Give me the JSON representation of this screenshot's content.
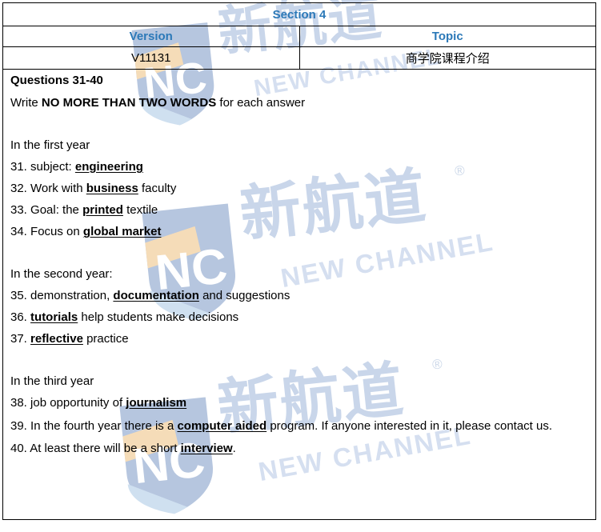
{
  "document": {
    "type": "ielts-listening-answer-key",
    "meta_table": {
      "section_title": "Section 4",
      "columns": [
        {
          "header": "Version",
          "value": "V11131"
        },
        {
          "header": "Topic",
          "value": "商学院课程介绍"
        }
      ]
    },
    "body": {
      "questions_heading": "Questions 31-40",
      "instruction": {
        "prefix": "Write ",
        "emphasis": "NO MORE THAN TWO WORDS",
        "suffix": " for each answer"
      },
      "groups": [
        {
          "group_label": "In the first year",
          "items": [
            {
              "number": "31.",
              "pre": " subject: ",
              "answer": "engineering",
              "post": ""
            },
            {
              "number": "32.",
              "pre": " Work with ",
              "answer": "business",
              "post": " faculty"
            },
            {
              "number": "33.",
              "pre": " Goal: the ",
              "answer": "printed",
              "post": " textile"
            },
            {
              "number": "34.",
              "pre": " Focus on ",
              "answer": "global market",
              "post": ""
            }
          ]
        },
        {
          "group_label": "In the second year:",
          "items": [
            {
              "number": "35.",
              "pre": " demonstration, ",
              "answer": "documentation",
              "post": " and suggestions"
            },
            {
              "number": "36.",
              "pre": " ",
              "answer": "tutorials",
              "post": " help students make decisions"
            },
            {
              "number": "37.",
              "pre": " ",
              "answer": "reflective",
              "post": " practice"
            }
          ]
        },
        {
          "group_label": "In the third year",
          "items": [
            {
              "number": "38.",
              "pre": " job opportunity of ",
              "answer": "journalism",
              "post": ""
            },
            {
              "number": "39.",
              "pre": " In the fourth year there is a ",
              "answer": "computer aided",
              "post": " program. If anyone interested in it, please contact us."
            },
            {
              "number": "40.",
              "pre": " At least there will be a short ",
              "answer": "interview",
              "post": "."
            }
          ]
        }
      ]
    }
  },
  "watermark": {
    "logo_letters": "NC",
    "chinese_brand": "新航道",
    "english_brand": "NEW CHANNEL",
    "registered_mark": "®"
  },
  "colors": {
    "header_blue": "#2c79b8",
    "watermark_blue": "#c9d6ea",
    "shield_dark": "#b6c6df",
    "shield_light": "#cfe0f0",
    "shield_accent": "#f5dcb8",
    "border": "#000000",
    "text": "#000000",
    "page_bg": "#ffffff"
  }
}
